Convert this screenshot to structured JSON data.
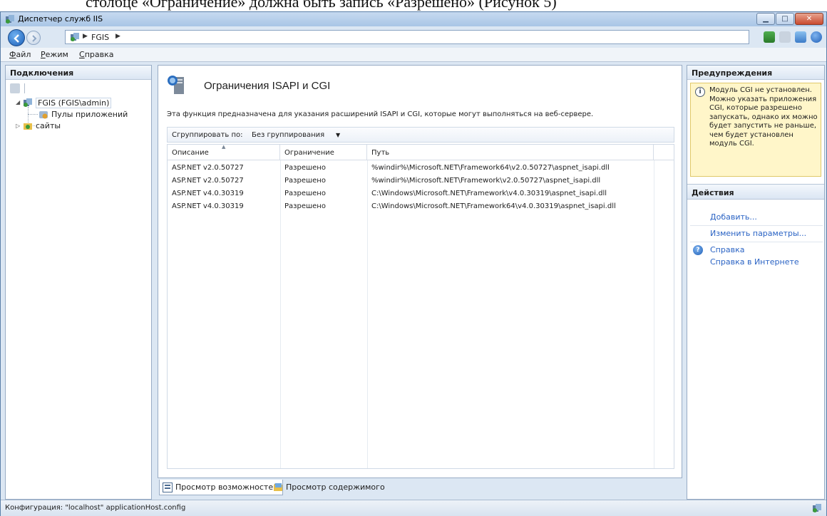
{
  "document_strip": {
    "text": "столбце «Ограничение» должна быть запись «Разрешено» (Рисунок 5)"
  },
  "window": {
    "title": "Диспетчер служб IIS",
    "controls": {
      "minimize": "▁",
      "maximize": "□",
      "close": "✕"
    }
  },
  "address": {
    "crumbs": [
      "FGIS"
    ]
  },
  "menu": {
    "items": [
      "Файл",
      "Режим",
      "Справка"
    ]
  },
  "connections": {
    "title": "Подключения",
    "tree": {
      "server": "FGIS (FGIS\\admin)",
      "app_pools": "Пулы приложений",
      "sites": "сайты"
    }
  },
  "feature": {
    "title": "Ограничения ISAPI и CGI",
    "description": "Эта функция предназначена для указания расширений ISAPI и CGI, которые могут выполняться на веб-сервере.",
    "group_by_label": "Сгруппировать по:",
    "group_by_value": "Без группирования",
    "columns": [
      "Описание",
      "Ограничение",
      "Путь"
    ],
    "rows": [
      {
        "description": "ASP.NET v2.0.50727",
        "restriction": "Разрешено",
        "path": "%windir%\\Microsoft.NET\\Framework64\\v2.0.50727\\aspnet_isapi.dll"
      },
      {
        "description": "ASP.NET v2.0.50727",
        "restriction": "Разрешено",
        "path": "%windir%\\Microsoft.NET\\Framework\\v2.0.50727\\aspnet_isapi.dll"
      },
      {
        "description": "ASP.NET v4.0.30319",
        "restriction": "Разрешено",
        "path": "C:\\Windows\\Microsoft.NET\\Framework\\v4.0.30319\\aspnet_isapi.dll"
      },
      {
        "description": "ASP.NET v4.0.30319",
        "restriction": "Разрешено",
        "path": "C:\\Windows\\Microsoft.NET\\Framework64\\v4.0.30319\\aspnet_isapi.dll"
      }
    ]
  },
  "view_tabs": {
    "features": "Просмотр возможностей",
    "content": "Просмотр содержимого"
  },
  "alerts": {
    "title": "Предупреждения",
    "message": "Модуль CGI не установлен. Можно указать приложения CGI, которые разрешено запускать, однако их можно будет запустить не раньше, чем будет установлен модуль CGI."
  },
  "actions": {
    "title": "Действия",
    "add": "Добавить...",
    "edit_settings": "Изменить параметры...",
    "help": "Справка",
    "online_help": "Справка в Интернете"
  },
  "status": {
    "text": "Конфигурация: \"localhost\" applicationHost.config"
  },
  "colors": {
    "link": "#2a63c4",
    "alert_bg": "#fff6c9",
    "chrome": "#dce7f3"
  }
}
